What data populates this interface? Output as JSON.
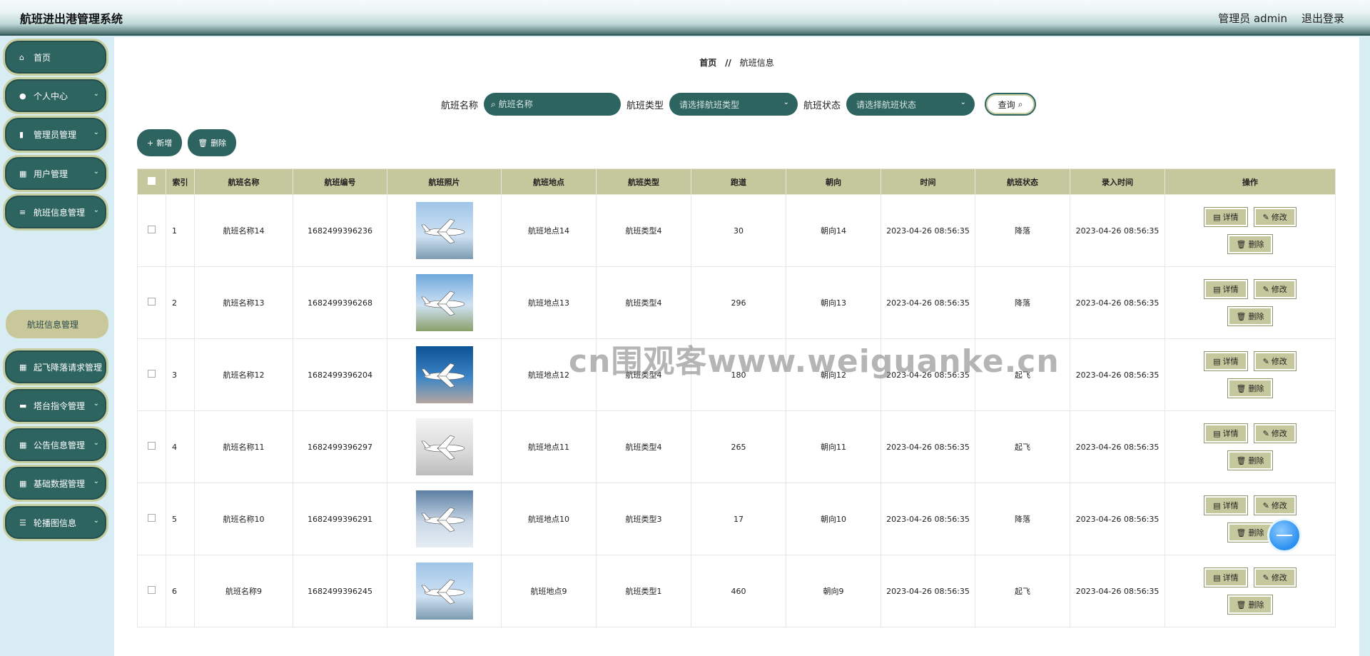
{
  "app": {
    "title": "航班进出港管理系统",
    "user_label": "管理员 admin",
    "logout": "退出登录"
  },
  "sidebar": {
    "items": [
      {
        "label": "首页",
        "icon": "home-icon",
        "glyph": "⌂",
        "chevron": false
      },
      {
        "label": "个人中心",
        "icon": "user-icon",
        "glyph": "👤",
        "chevron": true
      },
      {
        "label": "管理员管理",
        "icon": "bar-chart-icon",
        "glyph": "▮",
        "chevron": true
      },
      {
        "label": "用户管理",
        "icon": "grid-icon",
        "glyph": "▦",
        "chevron": true
      },
      {
        "label": "航班信息管理",
        "icon": "list-icon",
        "glyph": "≡",
        "chevron": true
      },
      {
        "label": "起飞降落请求管理",
        "icon": "grid-icon",
        "glyph": "▦",
        "chevron": true
      },
      {
        "label": "塔台指令管理",
        "icon": "briefcase-icon",
        "glyph": "▬",
        "chevron": true
      },
      {
        "label": "公告信息管理",
        "icon": "grid-icon",
        "glyph": "▦",
        "chevron": true
      },
      {
        "label": "基础数据管理",
        "icon": "grid-icon",
        "glyph": "▦",
        "chevron": true
      },
      {
        "label": "轮播图信息",
        "icon": "sliders-icon",
        "glyph": "☰",
        "chevron": true
      }
    ],
    "submenu": {
      "label": "航班信息管理"
    }
  },
  "breadcrumb": {
    "home": "首页",
    "sep": "//",
    "current": "航班信息"
  },
  "search": {
    "name_label": "航班名称",
    "name_placeholder": "航班名称",
    "type_label": "航班类型",
    "type_placeholder": "请选择航班类型",
    "status_label": "航班状态",
    "status_placeholder": "请选择航班状态",
    "query": "查询"
  },
  "actions": {
    "add": "新增",
    "delete": "删除"
  },
  "table": {
    "headers": [
      "索引",
      "航班名称",
      "航班编号",
      "航班照片",
      "航班地点",
      "航班类型",
      "跑道",
      "朝向",
      "时间",
      "航班状态",
      "录入时间",
      "操作"
    ],
    "ops": {
      "detail": "详情",
      "edit": "修改",
      "delete": "删除"
    },
    "rows": [
      {
        "index": "1",
        "name": "航班名称14",
        "code": "1682499396236",
        "place": "航班地点14",
        "type": "航班类型4",
        "runway": "30",
        "heading": "朝向14",
        "time": "2023-04-26 08:56:35",
        "status": "降落",
        "created": "2023-04-26 08:56:35"
      },
      {
        "index": "2",
        "name": "航班名称13",
        "code": "1682499396268",
        "place": "航班地点13",
        "type": "航班类型4",
        "runway": "296",
        "heading": "朝向13",
        "time": "2023-04-26 08:56:35",
        "status": "降落",
        "created": "2023-04-26 08:56:35"
      },
      {
        "index": "3",
        "name": "航班名称12",
        "code": "1682499396204",
        "place": "航班地点12",
        "type": "航班类型4",
        "runway": "180",
        "heading": "朝向12",
        "time": "2023-04-26 08:56:35",
        "status": "起飞",
        "created": "2023-04-26 08:56:35"
      },
      {
        "index": "4",
        "name": "航班名称11",
        "code": "1682499396297",
        "place": "航班地点11",
        "type": "航班类型4",
        "runway": "265",
        "heading": "朝向11",
        "time": "2023-04-26 08:56:35",
        "status": "起飞",
        "created": "2023-04-26 08:56:35"
      },
      {
        "index": "5",
        "name": "航班名称10",
        "code": "1682499396291",
        "place": "航班地点10",
        "type": "航班类型3",
        "runway": "17",
        "heading": "朝向10",
        "time": "2023-04-26 08:56:35",
        "status": "降落",
        "created": "2023-04-26 08:56:35"
      },
      {
        "index": "6",
        "name": "航班名称9",
        "code": "1682499396245",
        "place": "航班地点9",
        "type": "航班类型1",
        "runway": "460",
        "heading": "朝向9",
        "time": "2023-04-26 08:56:35",
        "status": "起飞",
        "created": "2023-04-26 08:56:35"
      }
    ]
  },
  "watermark": "cn围观客www.weiguanke.cn"
}
